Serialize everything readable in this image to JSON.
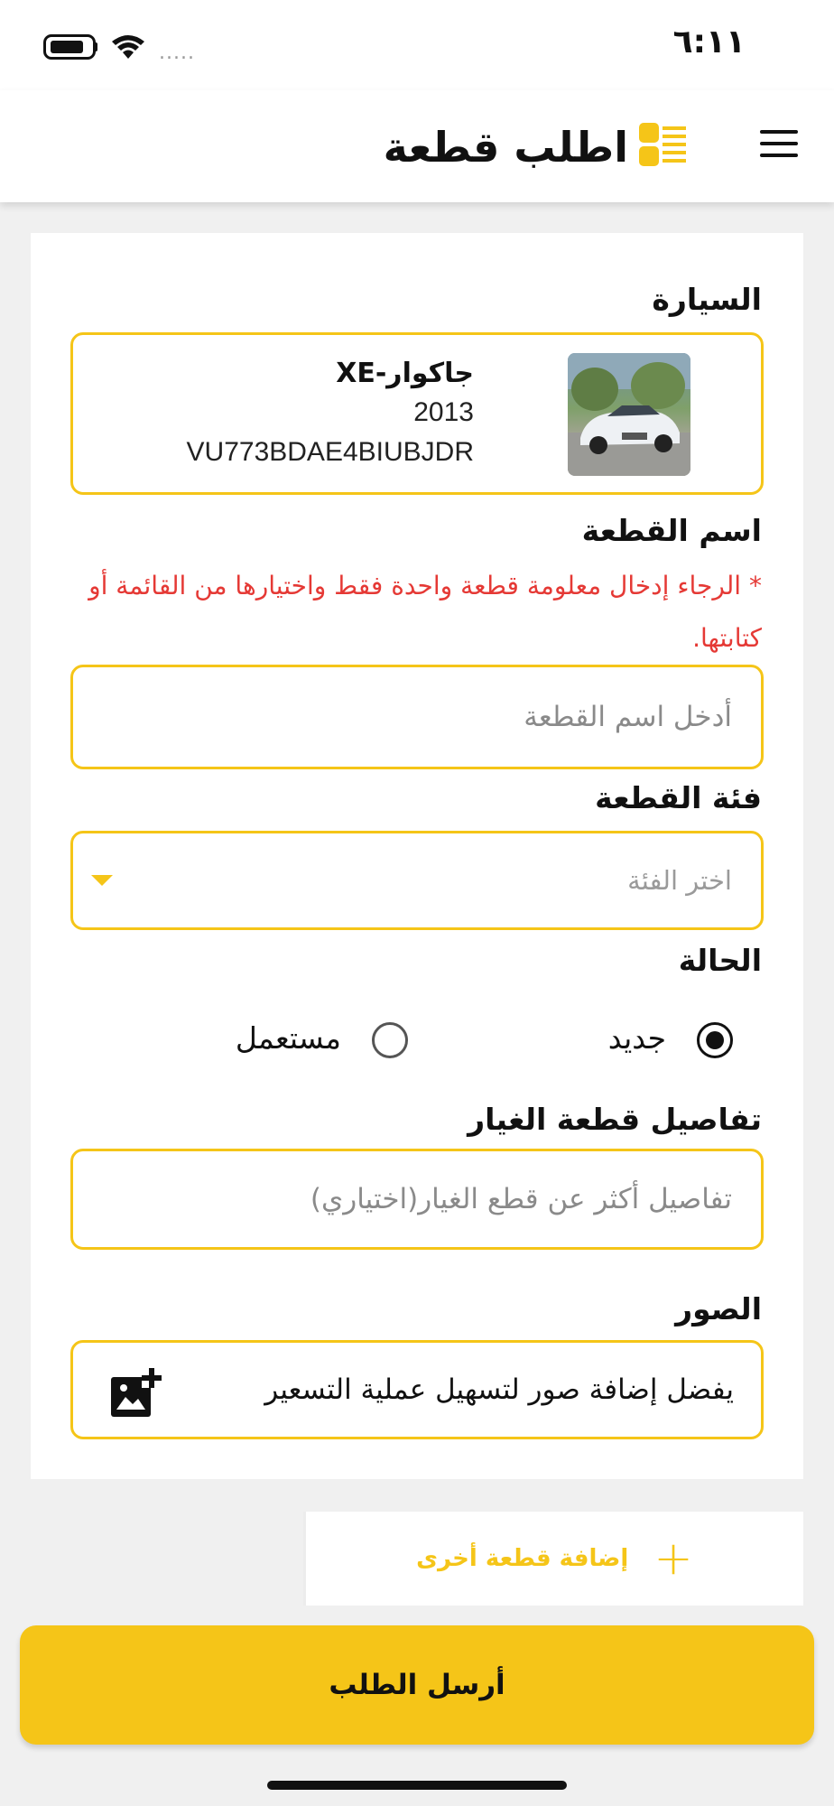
{
  "status_bar": {
    "time": "٦:١١",
    "signal": "....."
  },
  "header": {
    "title": "اطلب قطعة",
    "logo_icon": "parts-list-icon",
    "menu_icon": "hamburger-menu-icon"
  },
  "car_section": {
    "label": "السيارة",
    "name": "جاكوار-XE",
    "year": "2013",
    "vin": "VU773BDAE4BIUBJDR",
    "image_icon": "car-photo"
  },
  "part_name": {
    "label": "اسم القطعة",
    "error": "* الرجاء إدخال معلومة قطعة واحدة فقط واختيارها من القائمة أو كتابتها.",
    "placeholder": "أدخل اسم القطعة"
  },
  "category": {
    "label": "فئة القطعة",
    "placeholder": "اختر الفئة",
    "arrow_icon": "dropdown-arrow-icon"
  },
  "condition": {
    "label": "الحالة",
    "options": [
      {
        "label": "جديد",
        "selected": true
      },
      {
        "label": "مستعمل",
        "selected": false
      }
    ]
  },
  "details": {
    "label": "تفاصيل قطعة الغيار",
    "placeholder": "تفاصيل أكثر عن قطع الغيار(اختياري)"
  },
  "photos": {
    "label": "الصور",
    "hint": "يفضل إضافة صور لتسهيل عملية التسعير",
    "icon": "add-photo-icon"
  },
  "add_part": {
    "label": "إضافة قطعة أخرى",
    "icon": "plus-icon"
  },
  "submit": {
    "label": "أرسل الطلب"
  },
  "colors": {
    "accent": "#f5c518",
    "error": "#e53935",
    "background": "#f0f0f0"
  }
}
